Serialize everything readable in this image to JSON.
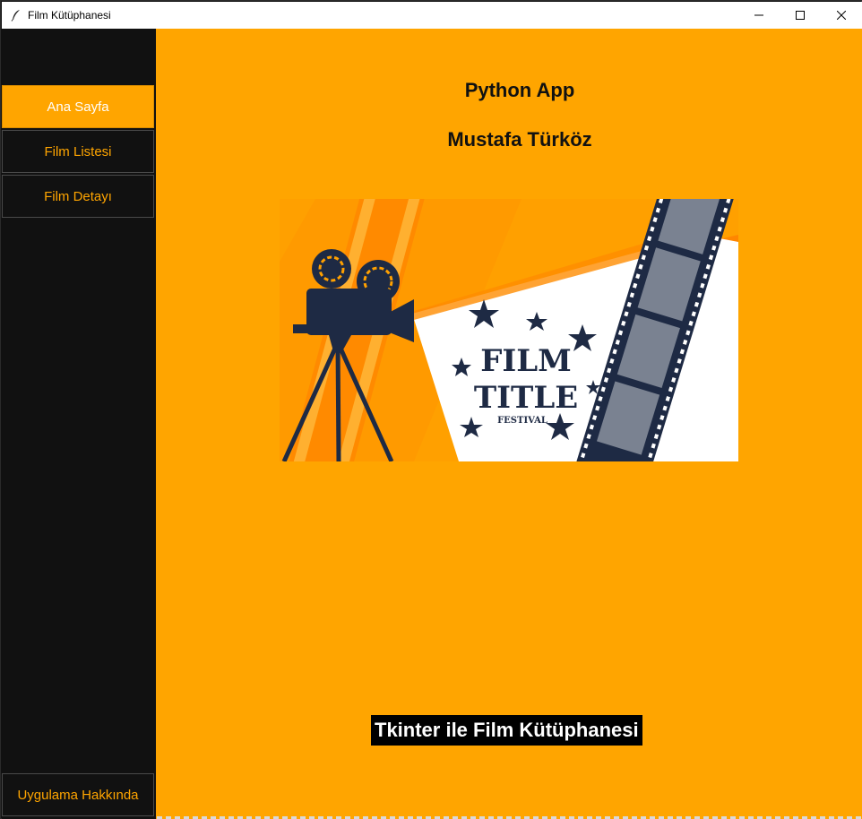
{
  "window": {
    "title": "Film Kütüphanesi"
  },
  "sidebar": {
    "items": [
      {
        "label": "Ana Sayfa",
        "active": true
      },
      {
        "label": "Film Listesi",
        "active": false
      },
      {
        "label": "Film Detayı",
        "active": false
      }
    ],
    "about_label": "Uygulama Hakkında"
  },
  "main": {
    "title": "Python App",
    "author": "Mustafa Türköz",
    "banner": {
      "line1": "FILM",
      "line2": "TITLE",
      "line3": "FESTIVAL"
    },
    "footer": "Tkinter ile Film Kütüphanesi"
  },
  "colors": {
    "accent": "#ffa500",
    "sidebar": "#111111",
    "banner_navy": "#1e2a44"
  },
  "icons": [
    "feather-icon",
    "minimize-icon",
    "maximize-icon",
    "close-icon",
    "movie-camera-icon",
    "film-strip-icon",
    "star-icon"
  ]
}
